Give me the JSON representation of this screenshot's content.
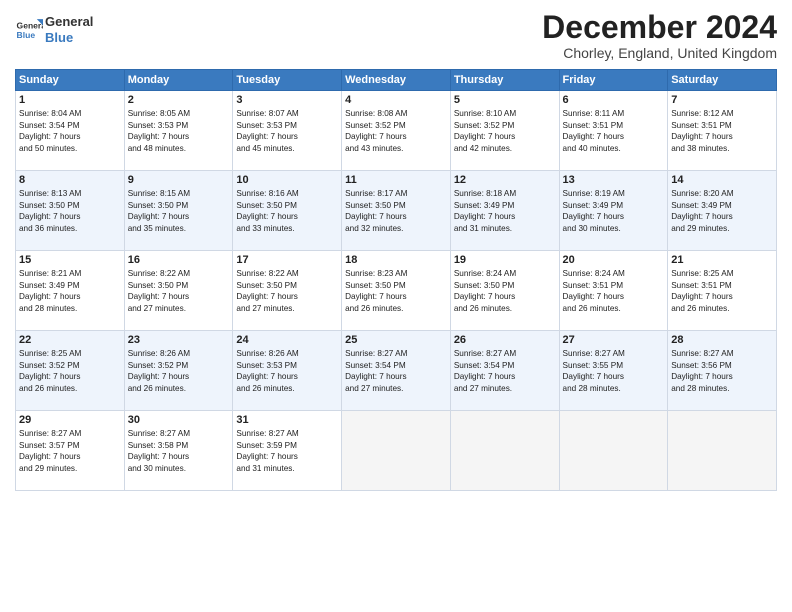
{
  "logo": {
    "line1": "General",
    "line2": "Blue"
  },
  "title": "December 2024",
  "location": "Chorley, England, United Kingdom",
  "days_of_week": [
    "Sunday",
    "Monday",
    "Tuesday",
    "Wednesday",
    "Thursday",
    "Friday",
    "Saturday"
  ],
  "weeks": [
    [
      {
        "day": "1",
        "lines": [
          "Sunrise: 8:04 AM",
          "Sunset: 3:54 PM",
          "Daylight: 7 hours",
          "and 50 minutes."
        ]
      },
      {
        "day": "2",
        "lines": [
          "Sunrise: 8:05 AM",
          "Sunset: 3:53 PM",
          "Daylight: 7 hours",
          "and 48 minutes."
        ]
      },
      {
        "day": "3",
        "lines": [
          "Sunrise: 8:07 AM",
          "Sunset: 3:53 PM",
          "Daylight: 7 hours",
          "and 45 minutes."
        ]
      },
      {
        "day": "4",
        "lines": [
          "Sunrise: 8:08 AM",
          "Sunset: 3:52 PM",
          "Daylight: 7 hours",
          "and 43 minutes."
        ]
      },
      {
        "day": "5",
        "lines": [
          "Sunrise: 8:10 AM",
          "Sunset: 3:52 PM",
          "Daylight: 7 hours",
          "and 42 minutes."
        ]
      },
      {
        "day": "6",
        "lines": [
          "Sunrise: 8:11 AM",
          "Sunset: 3:51 PM",
          "Daylight: 7 hours",
          "and 40 minutes."
        ]
      },
      {
        "day": "7",
        "lines": [
          "Sunrise: 8:12 AM",
          "Sunset: 3:51 PM",
          "Daylight: 7 hours",
          "and 38 minutes."
        ]
      }
    ],
    [
      {
        "day": "8",
        "lines": [
          "Sunrise: 8:13 AM",
          "Sunset: 3:50 PM",
          "Daylight: 7 hours",
          "and 36 minutes."
        ]
      },
      {
        "day": "9",
        "lines": [
          "Sunrise: 8:15 AM",
          "Sunset: 3:50 PM",
          "Daylight: 7 hours",
          "and 35 minutes."
        ]
      },
      {
        "day": "10",
        "lines": [
          "Sunrise: 8:16 AM",
          "Sunset: 3:50 PM",
          "Daylight: 7 hours",
          "and 33 minutes."
        ]
      },
      {
        "day": "11",
        "lines": [
          "Sunrise: 8:17 AM",
          "Sunset: 3:50 PM",
          "Daylight: 7 hours",
          "and 32 minutes."
        ]
      },
      {
        "day": "12",
        "lines": [
          "Sunrise: 8:18 AM",
          "Sunset: 3:49 PM",
          "Daylight: 7 hours",
          "and 31 minutes."
        ]
      },
      {
        "day": "13",
        "lines": [
          "Sunrise: 8:19 AM",
          "Sunset: 3:49 PM",
          "Daylight: 7 hours",
          "and 30 minutes."
        ]
      },
      {
        "day": "14",
        "lines": [
          "Sunrise: 8:20 AM",
          "Sunset: 3:49 PM",
          "Daylight: 7 hours",
          "and 29 minutes."
        ]
      }
    ],
    [
      {
        "day": "15",
        "lines": [
          "Sunrise: 8:21 AM",
          "Sunset: 3:49 PM",
          "Daylight: 7 hours",
          "and 28 minutes."
        ]
      },
      {
        "day": "16",
        "lines": [
          "Sunrise: 8:22 AM",
          "Sunset: 3:50 PM",
          "Daylight: 7 hours",
          "and 27 minutes."
        ]
      },
      {
        "day": "17",
        "lines": [
          "Sunrise: 8:22 AM",
          "Sunset: 3:50 PM",
          "Daylight: 7 hours",
          "and 27 minutes."
        ]
      },
      {
        "day": "18",
        "lines": [
          "Sunrise: 8:23 AM",
          "Sunset: 3:50 PM",
          "Daylight: 7 hours",
          "and 26 minutes."
        ]
      },
      {
        "day": "19",
        "lines": [
          "Sunrise: 8:24 AM",
          "Sunset: 3:50 PM",
          "Daylight: 7 hours",
          "and 26 minutes."
        ]
      },
      {
        "day": "20",
        "lines": [
          "Sunrise: 8:24 AM",
          "Sunset: 3:51 PM",
          "Daylight: 7 hours",
          "and 26 minutes."
        ]
      },
      {
        "day": "21",
        "lines": [
          "Sunrise: 8:25 AM",
          "Sunset: 3:51 PM",
          "Daylight: 7 hours",
          "and 26 minutes."
        ]
      }
    ],
    [
      {
        "day": "22",
        "lines": [
          "Sunrise: 8:25 AM",
          "Sunset: 3:52 PM",
          "Daylight: 7 hours",
          "and 26 minutes."
        ]
      },
      {
        "day": "23",
        "lines": [
          "Sunrise: 8:26 AM",
          "Sunset: 3:52 PM",
          "Daylight: 7 hours",
          "and 26 minutes."
        ]
      },
      {
        "day": "24",
        "lines": [
          "Sunrise: 8:26 AM",
          "Sunset: 3:53 PM",
          "Daylight: 7 hours",
          "and 26 minutes."
        ]
      },
      {
        "day": "25",
        "lines": [
          "Sunrise: 8:27 AM",
          "Sunset: 3:54 PM",
          "Daylight: 7 hours",
          "and 27 minutes."
        ]
      },
      {
        "day": "26",
        "lines": [
          "Sunrise: 8:27 AM",
          "Sunset: 3:54 PM",
          "Daylight: 7 hours",
          "and 27 minutes."
        ]
      },
      {
        "day": "27",
        "lines": [
          "Sunrise: 8:27 AM",
          "Sunset: 3:55 PM",
          "Daylight: 7 hours",
          "and 28 minutes."
        ]
      },
      {
        "day": "28",
        "lines": [
          "Sunrise: 8:27 AM",
          "Sunset: 3:56 PM",
          "Daylight: 7 hours",
          "and 28 minutes."
        ]
      }
    ],
    [
      {
        "day": "29",
        "lines": [
          "Sunrise: 8:27 AM",
          "Sunset: 3:57 PM",
          "Daylight: 7 hours",
          "and 29 minutes."
        ]
      },
      {
        "day": "30",
        "lines": [
          "Sunrise: 8:27 AM",
          "Sunset: 3:58 PM",
          "Daylight: 7 hours",
          "and 30 minutes."
        ]
      },
      {
        "day": "31",
        "lines": [
          "Sunrise: 8:27 AM",
          "Sunset: 3:59 PM",
          "Daylight: 7 hours",
          "and 31 minutes."
        ]
      },
      null,
      null,
      null,
      null
    ]
  ]
}
